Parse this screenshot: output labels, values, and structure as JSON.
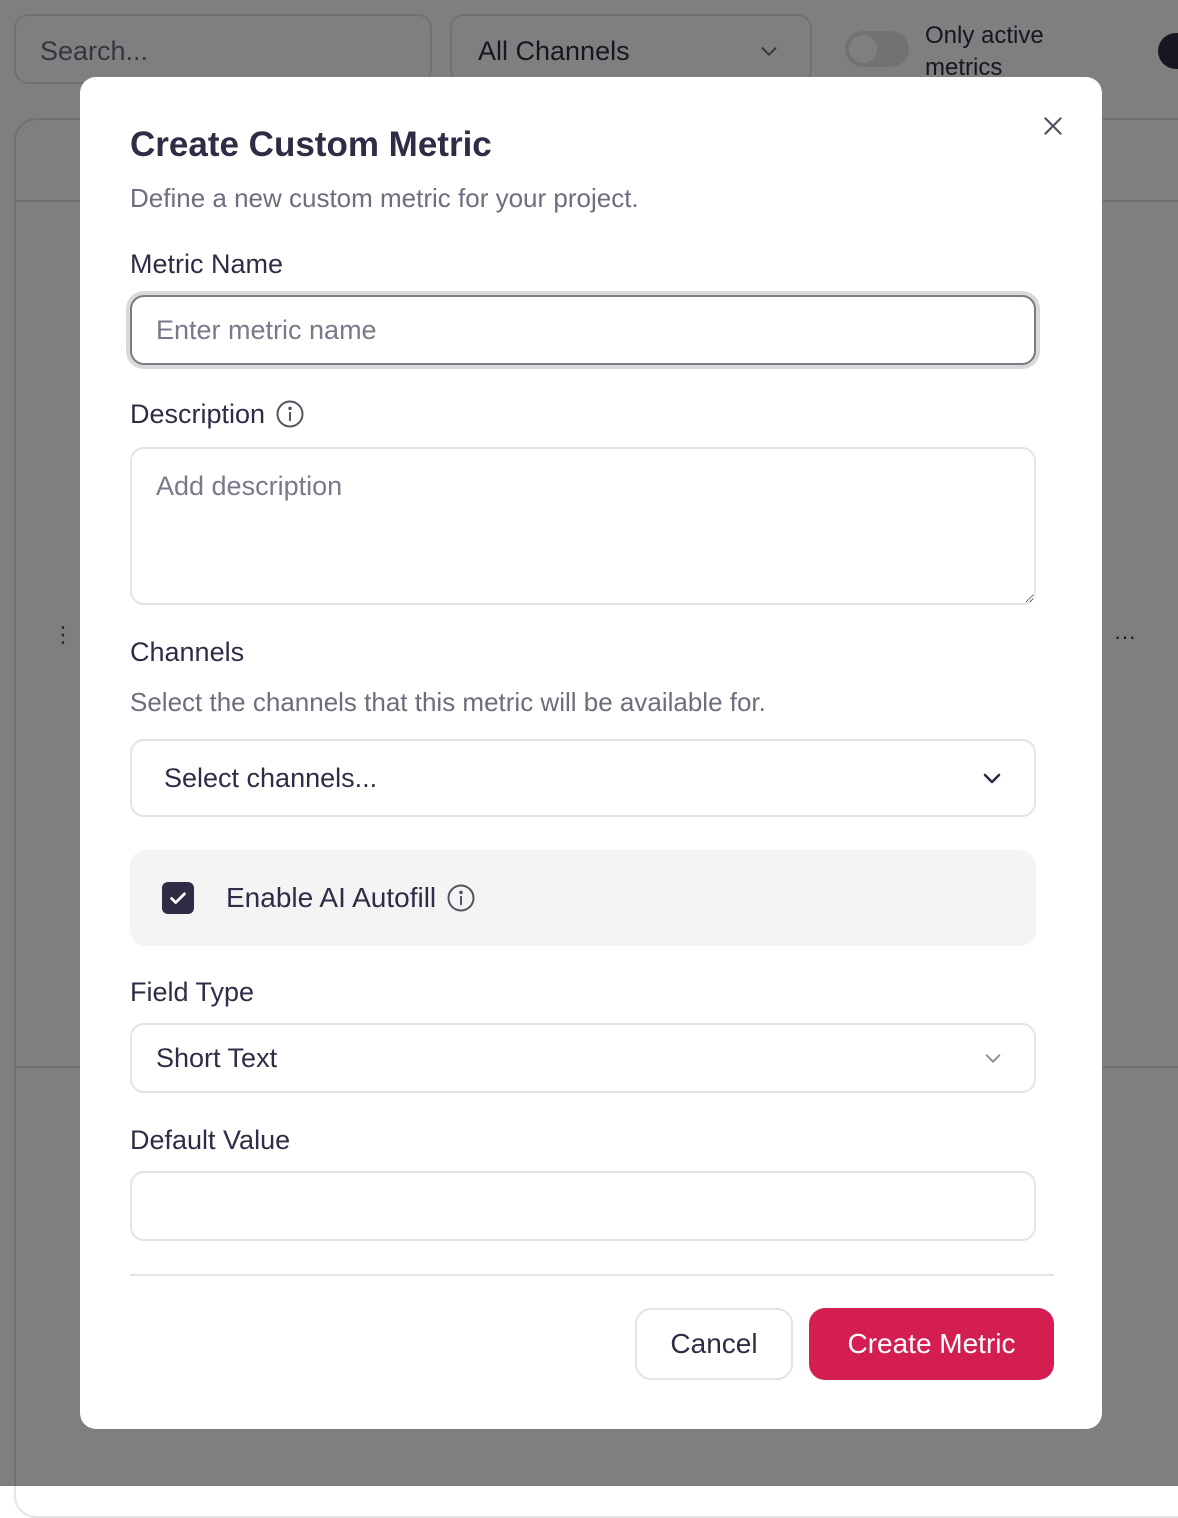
{
  "background": {
    "search_placeholder": "Search...",
    "channel_filter_value": "All Channels",
    "active_toggle_label": "Only active metrics",
    "active_toggle_on": false
  },
  "modal": {
    "title": "Create Custom Metric",
    "subtitle": "Define a new custom metric for your project.",
    "metric_name": {
      "label": "Metric Name",
      "placeholder": "Enter metric name",
      "value": ""
    },
    "description": {
      "label": "Description",
      "placeholder": "Add description",
      "value": ""
    },
    "channels": {
      "label": "Channels",
      "help": "Select the channels that this metric will be available for.",
      "placeholder": "Select channels..."
    },
    "ai_autofill": {
      "label": "Enable AI Autofill",
      "checked": true
    },
    "field_type": {
      "label": "Field Type",
      "value": "Short Text"
    },
    "default_value": {
      "label": "Default Value",
      "value": ""
    },
    "buttons": {
      "cancel": "Cancel",
      "create": "Create Metric"
    }
  },
  "colors": {
    "primary": "#d41e52",
    "text": "#2f2c45",
    "muted": "#6f6c7d",
    "border": "#e3e3e8",
    "checkbox": "#2f2c45"
  },
  "icons": [
    "close-icon",
    "info-icon",
    "chevron-down-icon",
    "check-icon",
    "drag-handle-icon",
    "more-icon"
  ]
}
